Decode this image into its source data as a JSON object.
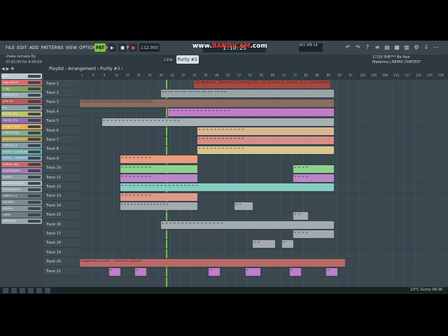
{
  "menu": [
    "FILE",
    "EDIT",
    "ADD",
    "PATTERNS",
    "VIEW",
    "OPTIONS",
    "TOOLS",
    "HELP"
  ],
  "transport": {
    "pat": "PAT",
    "song": "SONG",
    "tempo": "112.000",
    "time": "1:10:23"
  },
  "watermark": {
    "pre": "www.",
    "brand": "BANDICAM",
    "post": ".com"
  },
  "hint": {
    "file": "shake remake.flp",
    "time": "37:01:00 for 4:00:00"
  },
  "user": "tmmark62",
  "cpu": "461 MB 14",
  "news": {
    "line1": "17/10  SHE*** Be Your",
    "line2": "Madonna | REMIX CONTEST"
  },
  "toolbar2": {
    "snap": "Line",
    "pattern": "Purity #3"
  },
  "playlist_title": "Playlist - Arrangement › Purity #3 ›",
  "browser_channels": [
    {
      "label": "Kick",
      "color": "#c0c8cc"
    },
    {
      "label": "Log Drum",
      "color": "#d56f6c"
    },
    {
      "label": "Clap",
      "color": "#7fa266"
    },
    {
      "label": "Pattern 3",
      "color": "#9ab0b8"
    },
    {
      "label": "EP1 AT",
      "color": "#b35c59"
    },
    {
      "label": "Fx",
      "color": "#8fa3a9"
    },
    {
      "label": "Purity #1",
      "color": "#b9c36a"
    },
    {
      "label": "Purity #2",
      "color": "#8f6fb2"
    },
    {
      "label": "Finger bass",
      "color": "#e7ad5b"
    },
    {
      "label": "FPM chord",
      "color": "#87aa8f"
    },
    {
      "label": "Bassline(Synth)",
      "color": "#a9975a"
    },
    {
      "label": "Pattern 9",
      "color": "#8a9bab"
    },
    {
      "label": "snare - (1)all.bre",
      "color": "#6fb4ad"
    },
    {
      "label": "snare - militaries 7",
      "color": "#7ca5c2"
    },
    {
      "label": "dribsa log",
      "color": "#c46b68"
    },
    {
      "label": "ifamamp62",
      "color": "#9d7cbb"
    },
    {
      "label": "Synth",
      "color": "#8b9ba2"
    },
    {
      "label": "second snare",
      "color": "#b0b8bc"
    },
    {
      "label": "tambourine",
      "color": "#8ea0a7"
    },
    {
      "label": "Pattern 2",
      "color": "#6a7b82"
    },
    {
      "label": "whistle",
      "color": "#7a8c93"
    },
    {
      "label": "block2",
      "color": "#8b969b"
    },
    {
      "label": "vibes",
      "color": "#6f7e85"
    },
    {
      "label": "adidians",
      "color": "#9aa5aa"
    }
  ],
  "ruler": [
    "1",
    "5",
    "9",
    "13",
    "17",
    "21",
    "25",
    "29",
    "33",
    "37",
    "41",
    "45",
    "49",
    "53",
    "57",
    "61",
    "65",
    "69",
    "73",
    "77",
    "81",
    "85",
    "89",
    "93",
    "97",
    "101",
    "105",
    "109",
    "113",
    "117",
    "121",
    "125",
    "129"
  ],
  "tracks": [
    "Track 1",
    "Track 2",
    "Track 3",
    "Track 4",
    "Track 5",
    "Track 6",
    "Track 7",
    "Track 8",
    "Track 9",
    "Track 10",
    "Track 11",
    "Track 12",
    "Track 13",
    "Track 14",
    "Track 15",
    "Track 16",
    "Track 17",
    "Track 18",
    "Track 19",
    "Track 20",
    "Track 21"
  ],
  "clips": [
    {
      "track": 1,
      "start": 0.31,
      "end": 0.68,
      "color": "#a8473f",
      "text": "«DJ Mabonna_Sweetest_Rimming_007__DJ Stream_ft_Eresani_Bruz_SkeevMadag"
    },
    {
      "track": 2,
      "start": 0.22,
      "end": 0.69,
      "color": "#9aa3a7",
      "text": "≡≡ ≡≡ ≡≡ ≡≡ ≡≡ ≡≡ ≡≡ ≡≡ ≡≡ ≡≡"
    },
    {
      "track": 3,
      "start": 0.0,
      "end": 0.69,
      "color": "#8a6c60",
      "text": "||||||||||||||||||||||||||||||||||||||||||||||||||||||||"
    },
    {
      "track": 4,
      "start": 0.24,
      "end": 0.69,
      "color": "#c27dc8",
      "text": "≡ ≡ ≡ ≡ ≡ ≡ ≡ ≡ ≡ ≡ ≡ ≡ ≡ ≡ ≡ ≡"
    },
    {
      "track": 5,
      "start": 0.06,
      "end": 0.69,
      "color": "#a7b0b4",
      "text": "≡ ≡ ≡ ≡ ≡ ≡ ≡ ≡ ≡ ≡ ≡ ≡ ≡ ≡ ≡ ≡ ≡ ≡ ≡ ≡"
    },
    {
      "track": 6,
      "start": 0.32,
      "end": 0.69,
      "color": "#d9b890",
      "text": "≡ ≡ ≡ ≡ ≡ ≡ ≡ ≡ ≡ ≡ ≡ ≡"
    },
    {
      "track": 7,
      "start": 0.32,
      "end": 0.69,
      "color": "#d78e86",
      "text": "≡ ≡ ≡ ≡ ≡ ≡ ≡ ≡ ≡ ≡ ≡ ≡"
    },
    {
      "track": 8,
      "start": 0.32,
      "end": 0.69,
      "color": "#d9c58e",
      "text": "≡ ≡ ≡ ≡ ≡ ≡ ≡ ≡ ≡ ≡ ≡ ≡"
    },
    {
      "track": 9,
      "start": 0.11,
      "end": 0.32,
      "color": "#ea9c7c",
      "text": "≡ ≡ ≡ ≡ ≡ ≡ ≡ ≡"
    },
    {
      "track": 10,
      "start": 0.11,
      "end": 0.32,
      "color": "#8ed18e",
      "text": "≡ ≡ ≡ ≡ ≡ ≡ ≡ ≡"
    },
    {
      "track": 10,
      "start": 0.58,
      "end": 0.69,
      "color": "#8ed18e",
      "text": "≡ ≡ ≡ ≡"
    },
    {
      "track": 11,
      "start": 0.11,
      "end": 0.32,
      "color": "#bd86c6",
      "text": "≡ ≡ ≡ ≡ ≡ ≡ ≡ ≡"
    },
    {
      "track": 11,
      "start": 0.58,
      "end": 0.69,
      "color": "#bd86c6",
      "text": "≡ ≡ ≡ ≡"
    },
    {
      "track": 12,
      "start": 0.11,
      "end": 0.69,
      "color": "#86cdc2",
      "text": "≡ ≡ ≡ ≡ ≡ ≡ ≡ ≡ ≡ ≡ ≡ ≡ ≡ ≡ ≡ ≡ ≡ ≡ ≡ ≡"
    },
    {
      "track": 13,
      "start": 0.11,
      "end": 0.32,
      "color": "#e29788",
      "text": "≡ ≡ ≡ ≡ ≡ ≡ ≡ ≡"
    },
    {
      "track": 14,
      "start": 0.11,
      "end": 0.32,
      "color": "#a3abb0",
      "text": "v v v v v v v v v v v v v v v"
    },
    {
      "track": 14,
      "start": 0.42,
      "end": 0.47,
      "color": "#a3abb0",
      "text": "≡ ≡"
    },
    {
      "track": 15,
      "start": 0.58,
      "end": 0.62,
      "color": "#a3abb0",
      "text": "≡ ≡"
    },
    {
      "track": 16,
      "start": 0.22,
      "end": 0.69,
      "color": "#a3abb0",
      "text": "≡ ≡ ≡ ≡ ≡ ≡ ≡ ≡ ≡ ≡ ≡ ≡ ≡ ≡ ≡ ≡"
    },
    {
      "track": 17,
      "start": 0.58,
      "end": 0.69,
      "color": "#a3abb0",
      "text": "≡ ≡ ≡ ≡"
    },
    {
      "track": 18,
      "start": 0.47,
      "end": 0.53,
      "color": "#a3abb0",
      "text": "≡ ≡"
    },
    {
      "track": 18,
      "start": 0.55,
      "end": 0.58,
      "color": "#a3abb0",
      "text": "≡"
    },
    {
      "track": 20,
      "start": 0.0,
      "end": 0.72,
      "color": "#b96965",
      "text": "magbonna vocals - Channel volume"
    },
    {
      "track": 21,
      "start": 0.08,
      "end": 0.11,
      "color": "#c27dc8",
      "text": "≡"
    },
    {
      "track": 21,
      "start": 0.15,
      "end": 0.18,
      "color": "#c27dc8",
      "text": "≡"
    },
    {
      "track": 21,
      "start": 0.35,
      "end": 0.38,
      "color": "#c27dc8",
      "text": "≡"
    },
    {
      "track": 21,
      "start": 0.45,
      "end": 0.49,
      "color": "#c27dc8",
      "text": "≡"
    },
    {
      "track": 21,
      "start": 0.57,
      "end": 0.6,
      "color": "#c27dc8",
      "text": "≡"
    },
    {
      "track": 21,
      "start": 0.67,
      "end": 0.7,
      "color": "#c27dc8",
      "text": "≡"
    }
  ],
  "taskbar": {
    "weather": "23°C  Sunny",
    "clock": "06:36"
  }
}
